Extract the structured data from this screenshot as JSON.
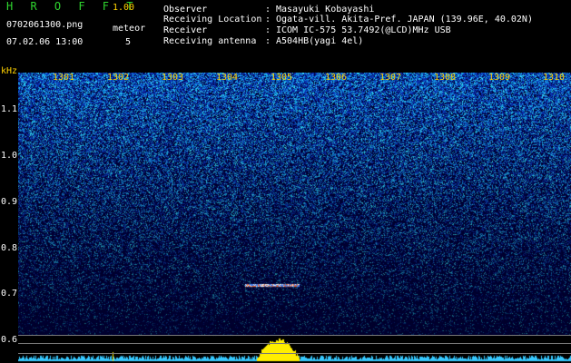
{
  "header": {
    "title": "H R O F F T",
    "version": "1.00",
    "file_name": "0702061300.png",
    "meteor_label": "meteor",
    "timestamp": "07.02.06 13:00",
    "meteor_count": "5"
  },
  "info": [
    {
      "key": "Observer",
      "value": "Masayuki Kobayashi"
    },
    {
      "key": "Receiving Location",
      "value": "Ogata-vill. Akita-Pref. JAPAN (139.96E, 40.02N)"
    },
    {
      "key": "Receiver",
      "value": "ICOM IC-575 53.7492(@LCD)MHz USB"
    },
    {
      "key": "Receiving antenna",
      "value": "A504HB(yagi 4el)"
    }
  ],
  "chart_data": {
    "type": "heatmap",
    "yaxis_unit": "kHz",
    "y_ticks": [
      "1.1",
      "1.0",
      "0.9",
      "0.8",
      "0.7",
      "0.6"
    ],
    "x_ticks": [
      "1301",
      "1302",
      "1303",
      "1304",
      "1305",
      "1306",
      "1307",
      "1308",
      "1309",
      "1310"
    ],
    "ylim": [
      0.59,
      1.17
    ],
    "meteor_echo_freq_khz": 0.72,
    "colors": {
      "background": "#000000",
      "noise_low": "#0a1aa0",
      "noise_mid": "#1f6dff",
      "noise_high": "#3ff2ff",
      "label_yellow": "#ffd200",
      "title_green": "#2fd52f",
      "spectrum_cyan": "#36c8ff",
      "spectrum_peak": "#ffee00"
    }
  }
}
